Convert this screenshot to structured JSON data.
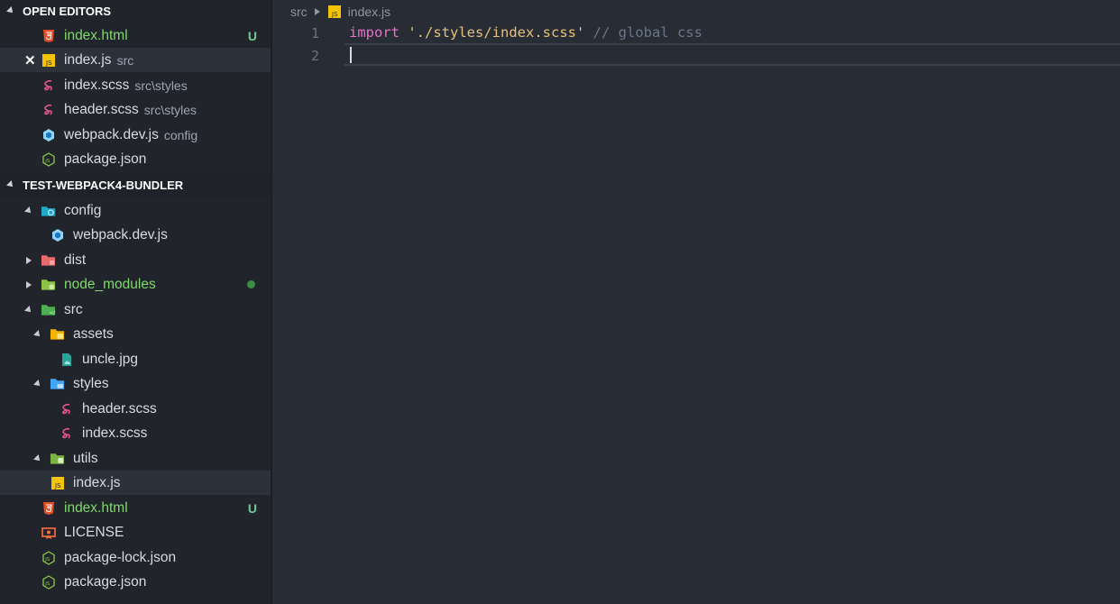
{
  "open_editors": {
    "title": "OPEN EDITORS",
    "items": [
      {
        "label": "index.html",
        "desc": "",
        "badge": "U",
        "icon": "html5-icon"
      },
      {
        "label": "index.js",
        "desc": "src",
        "badge": "",
        "icon": "js-icon",
        "close": "✕"
      },
      {
        "label": "index.scss",
        "desc": "src\\styles",
        "badge": "",
        "icon": "sass-icon"
      },
      {
        "label": "header.scss",
        "desc": "src\\styles",
        "badge": "",
        "icon": "sass-icon"
      },
      {
        "label": "webpack.dev.js",
        "desc": "config",
        "badge": "",
        "icon": "webpack-icon"
      },
      {
        "label": "package.json",
        "desc": "",
        "badge": "",
        "icon": "nodejs-icon"
      }
    ]
  },
  "project": {
    "title": "TEST-WEBPACK4-BUNDLER",
    "items": [
      {
        "label": "config",
        "icon": "folder-config-icon"
      },
      {
        "label": "webpack.dev.js",
        "icon": "webpack-icon"
      },
      {
        "label": "dist",
        "icon": "folder-dist-icon"
      },
      {
        "label": "node_modules",
        "icon": "folder-node-icon"
      },
      {
        "label": "src",
        "icon": "folder-src-icon"
      },
      {
        "label": "assets",
        "icon": "folder-assets-icon"
      },
      {
        "label": "uncle.jpg",
        "icon": "image-icon"
      },
      {
        "label": "styles",
        "icon": "folder-styles-icon"
      },
      {
        "label": "header.scss",
        "icon": "sass-icon"
      },
      {
        "label": "index.scss",
        "icon": "sass-icon"
      },
      {
        "label": "utils",
        "icon": "folder-utils-icon"
      },
      {
        "label": "index.js",
        "icon": "js-icon"
      },
      {
        "label": "index.html",
        "icon": "html5-icon",
        "badge": "U"
      },
      {
        "label": "LICENSE",
        "icon": "license-icon"
      },
      {
        "label": "package-lock.json",
        "icon": "nodejs-icon"
      },
      {
        "label": "package.json",
        "icon": "nodejs-icon"
      }
    ]
  },
  "breadcrumb": {
    "folder": "src",
    "file": "index.js"
  },
  "editor": {
    "line_numbers": [
      "1",
      "2"
    ],
    "line1": {
      "keyword": "import",
      "string": "'./styles/index.scss'",
      "comment": "// global css"
    }
  },
  "colors": {
    "accent_green": "#7fd96b",
    "keyword": "#e870c6",
    "string": "#e5c07b"
  }
}
